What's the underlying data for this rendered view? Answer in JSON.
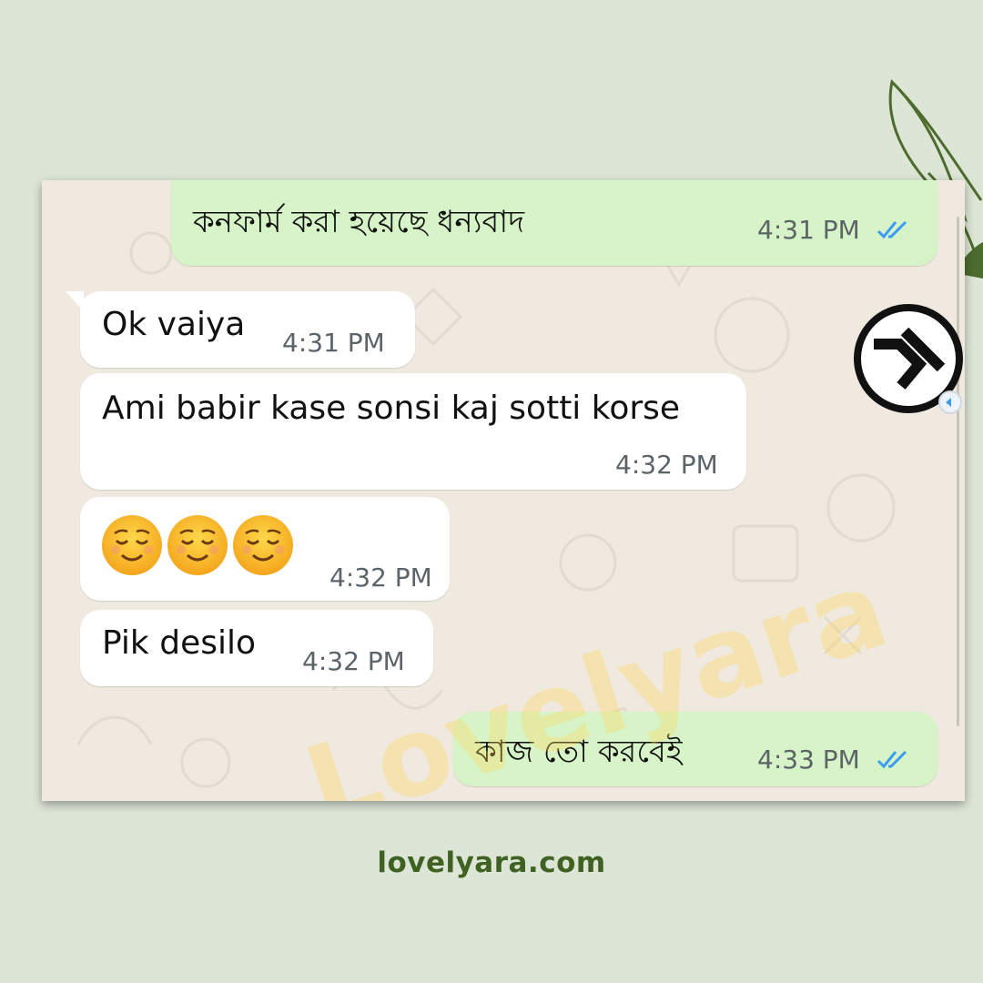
{
  "colors": {
    "background": "#dde5d6",
    "chat_background": "#efe9df",
    "outgoing_bubble": "#d7f4c8",
    "incoming_bubble": "#ffffff",
    "read_ticks": "#3b9cf2",
    "footer_text": "#3f6222"
  },
  "messages": [
    {
      "direction": "outgoing",
      "text": "কনফার্ম করা হয়েছে ধন্যবাদ",
      "time": "4:31 PM",
      "status": "read-double-tick-icon"
    },
    {
      "direction": "incoming",
      "text": "Ok vaiya",
      "time": "4:31 PM"
    },
    {
      "direction": "incoming",
      "text": "Ami babir kase sonsi kaj sotti korse",
      "time": "4:32 PM"
    },
    {
      "direction": "incoming",
      "emoji": [
        "relieved-face-emoji",
        "relieved-face-emoji",
        "relieved-face-emoji"
      ],
      "time": "4:32 PM"
    },
    {
      "direction": "incoming",
      "text": "Pik desilo",
      "time": "4:32 PM"
    },
    {
      "direction": "outgoing",
      "text": "কাজ তো করবেই",
      "time": "4:33 PM",
      "status": "read-double-tick-icon"
    }
  ],
  "watermark": "Lovelyara",
  "footer": {
    "site": "lovelyara.com"
  },
  "icons": {
    "avatar": "brand-logo-icon",
    "decoration": "leaf-icon"
  }
}
